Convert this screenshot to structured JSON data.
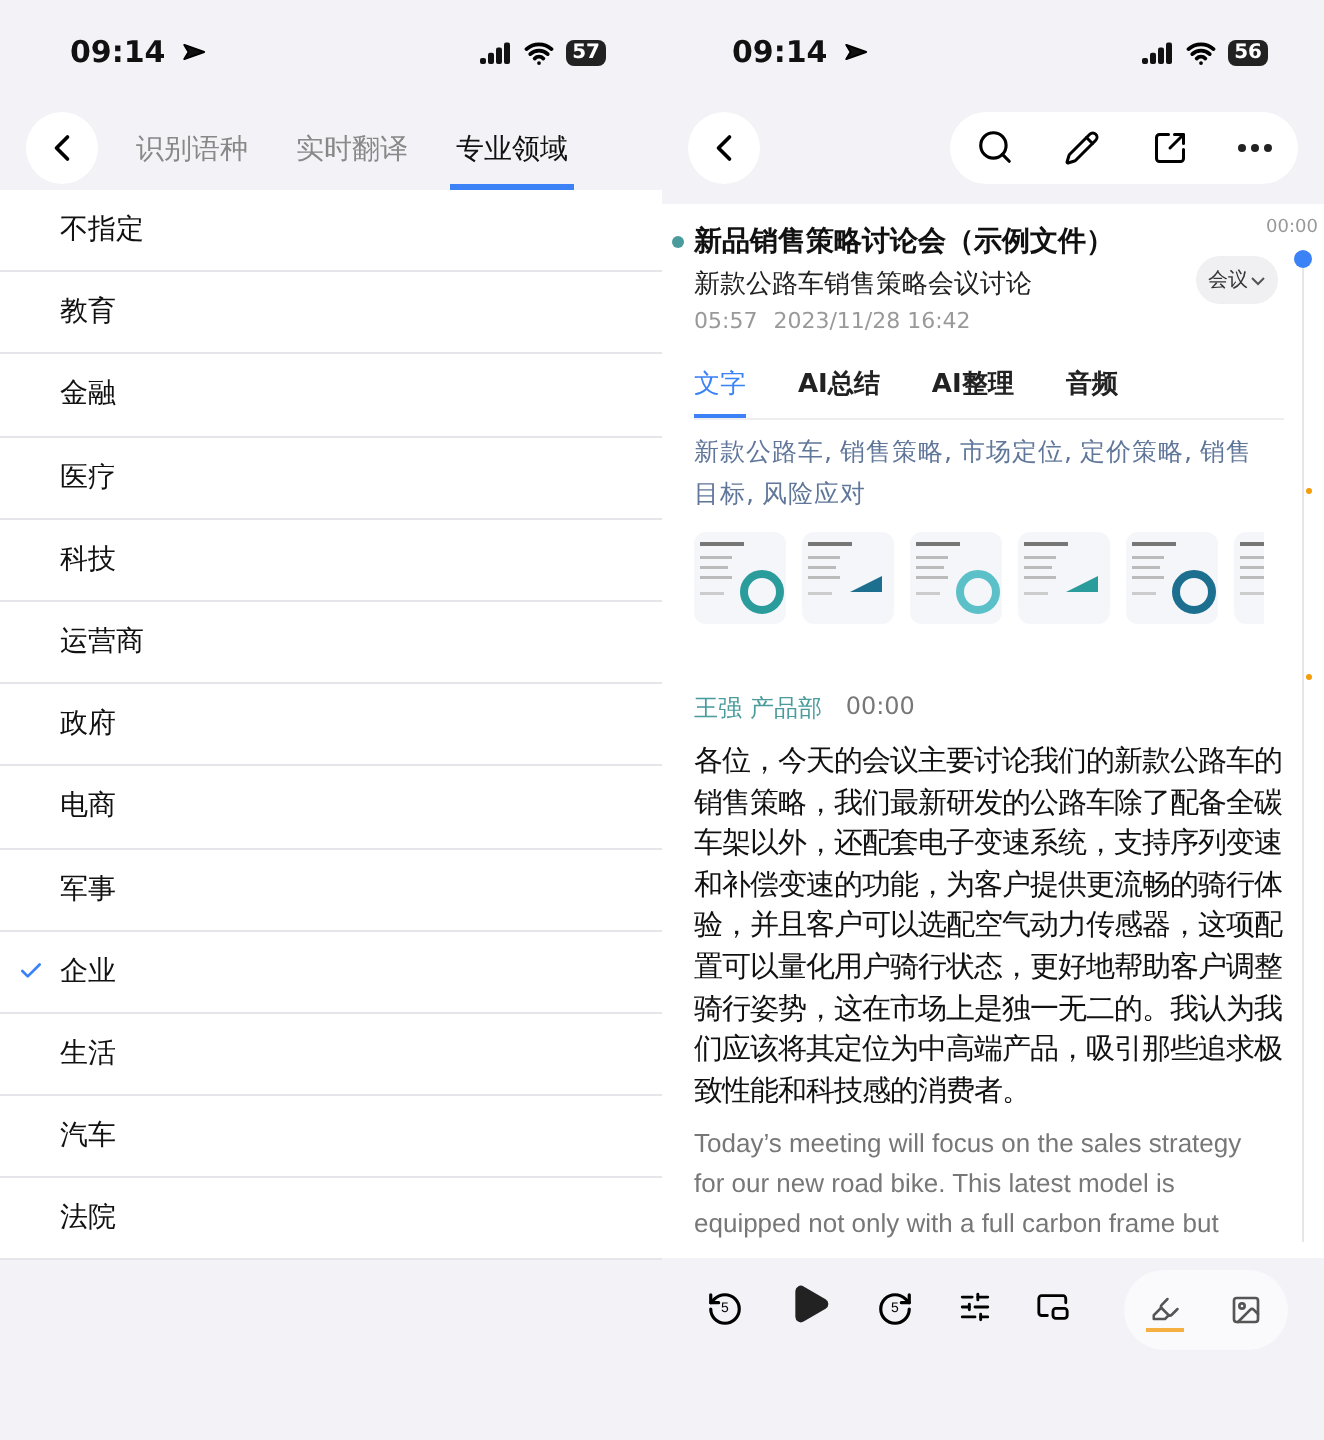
{
  "left": {
    "status_bar": {
      "time": "09:14",
      "battery": "57"
    },
    "tabs": [
      {
        "label": "识别语种",
        "selected": false
      },
      {
        "label": "实时翻译",
        "selected": false
      },
      {
        "label": "专业领域",
        "selected": true
      }
    ],
    "domains": [
      {
        "label": "不指定",
        "selected": false
      },
      {
        "label": "教育",
        "selected": false
      },
      {
        "label": "金融",
        "selected": false
      },
      {
        "label": "医疗",
        "selected": false
      },
      {
        "label": "科技",
        "selected": false
      },
      {
        "label": "运营商",
        "selected": false
      },
      {
        "label": "政府",
        "selected": false
      },
      {
        "label": "电商",
        "selected": false
      },
      {
        "label": "军事",
        "selected": false
      },
      {
        "label": "企业",
        "selected": true
      },
      {
        "label": "生活",
        "selected": false
      },
      {
        "label": "汽车",
        "selected": false
      },
      {
        "label": "法院",
        "selected": false
      }
    ]
  },
  "right": {
    "status_bar": {
      "time": "09:14",
      "battery": "56"
    },
    "title": "新品销售策略讨论会（示例文件）",
    "subtitle": "新款公路车销售策略会议讨论",
    "duration": "05:57",
    "datetime": "2023/11/28 16:42",
    "tag": "会议",
    "tabs": [
      {
        "label": "文字",
        "selected": true
      },
      {
        "label": "AI总结",
        "selected": false
      },
      {
        "label": "AI整理",
        "selected": false
      },
      {
        "label": "音频",
        "selected": false
      }
    ],
    "keywords": "新款公路车, 销售策略, 市场定位, 定价策略, 销售目标, 风险应对",
    "timeline_time": "00:00",
    "speaker": "王强 产品部",
    "timestamp": "00:00",
    "transcript": "各位，今天的会议主要讨论我们的新款公路车的销售策略，我们最新研发的公路车除了配备全碳车架以外，还配套电子变速系统，支持序列变速和补偿变速的功能，为客户提供更流畅的骑行体验，并且客户可以选配空气动力传感器，这项配置可以量化用户骑行状态，更好地帮助客户调整骑行姿势，这在市场上是独一无二的。我认为我们应该将其定位为中高端产品，吸引那些追求极致性能和科技感的消费者。",
    "translation": "Today’s meeting will focus on the sales strategy for our new road bike. This latest model is equipped not only with a full carbon frame but",
    "player": {
      "rewind": "5",
      "forward": "5"
    }
  }
}
